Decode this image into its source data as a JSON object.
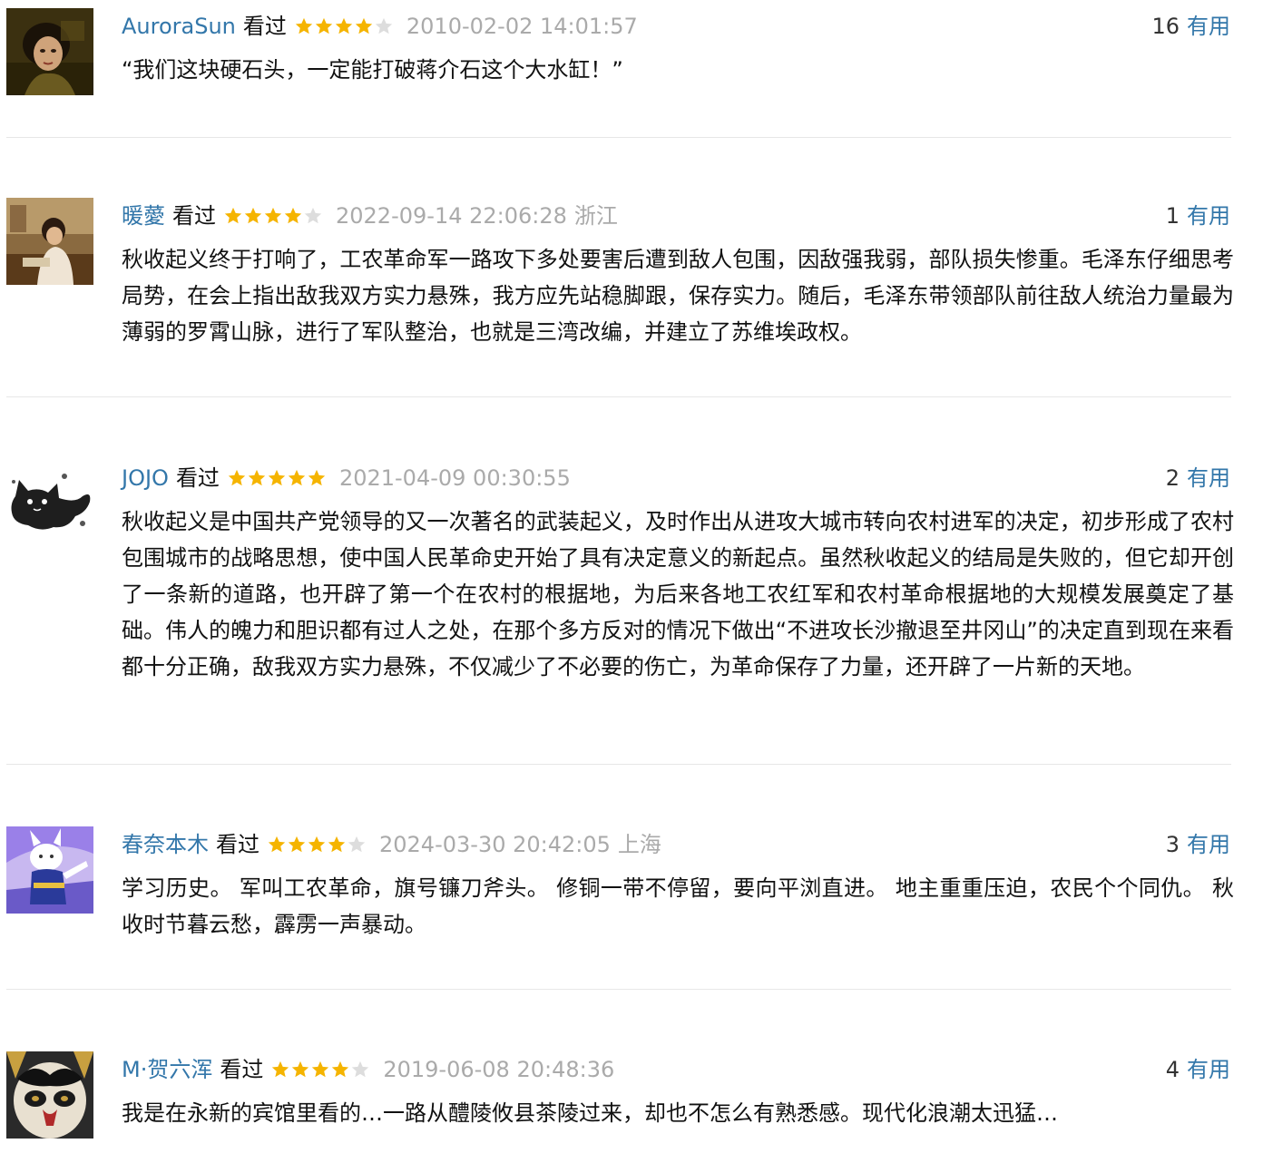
{
  "reviews": [
    {
      "username": "AuroraSun",
      "watched": "看过",
      "rating": 4,
      "time": "2010-02-02 14:01:57",
      "location": "",
      "votes": "16",
      "useful_label": "有用",
      "content": "“我们这块硬石头，一定能打破蒋介石这个大水缸！”",
      "avatar": "portrait-woman-icon"
    },
    {
      "username": "暖薆",
      "watched": "看过",
      "rating": 4,
      "time": "2022-09-14 22:06:28",
      "location": "浙江",
      "votes": "1",
      "useful_label": "有用",
      "content": "秋收起义终于打响了，工农革命军一路攻下多处要害后遭到敌人包围，因敌强我弱，部队损失惨重。毛泽东仔细思考局势，在会上指出敌我双方实力悬殊，我方应先站稳脚跟，保存实力。随后，毛泽东带领部队前往敌人统治力量最为薄弱的罗霄山脉，进行了军队整治，也就是三湾改编，并建立了苏维埃政权。",
      "avatar": "reading-girl-icon"
    },
    {
      "username": "JOJO",
      "watched": "看过",
      "rating": 5,
      "time": "2021-04-09 00:30:55",
      "location": "",
      "votes": "2",
      "useful_label": "有用",
      "content": "秋收起义是中国共产党领导的又一次著名的武装起义，及时作出从进攻大城市转向农村进军的决定，初步形成了农村包围城市的战略思想，使中国人民革命史开始了具有决定意义的新起点。虽然秋收起义的结局是失败的，但它却开创了一条新的道路，也开辟了第一个在农村的根据地，为后来各地工农红军和农村革命根据地的大规模发展奠定了基础。伟人的魄力和胆识都有过人之处，在那个多方反对的情况下做出“不进攻长沙撤退至井冈山”的决定直到现在来看都十分正确，敌我双方实力悬殊，不仅减少了不必要的伤亡，为革命保存了力量，还开辟了一片新的天地。",
      "avatar": "black-cat-icon"
    },
    {
      "username": "春奈本木",
      "watched": "看过",
      "rating": 4,
      "time": "2024-03-30 20:42:05",
      "location": "上海",
      "votes": "3",
      "useful_label": "有用",
      "content": "学习历史。 军叫工农革命，旗号镰刀斧头。 修铜一带不停留，要向平浏直进。 地主重重压迫，农民个个同仇。 秋收时节暮云愁，霹雳一声暴动。",
      "avatar": "anime-rabbit-icon"
    },
    {
      "username": "M·贺六浑",
      "watched": "看过",
      "rating": 4,
      "time": "2019-06-08 20:48:36",
      "location": "",
      "votes": "4",
      "useful_label": "有用",
      "content": "我是在永新的宾馆里看的…一路从醴陵攸县茶陵过来，却也不怎么有熟悉感。现代化浪潮太迅猛…",
      "avatar": "opera-mask-icon"
    }
  ],
  "colors": {
    "username": "#3377aa",
    "meta": "#aaaaaa",
    "star_on": "#f5b400",
    "star_off": "#dddddd",
    "divider": "#e7e7e7"
  }
}
